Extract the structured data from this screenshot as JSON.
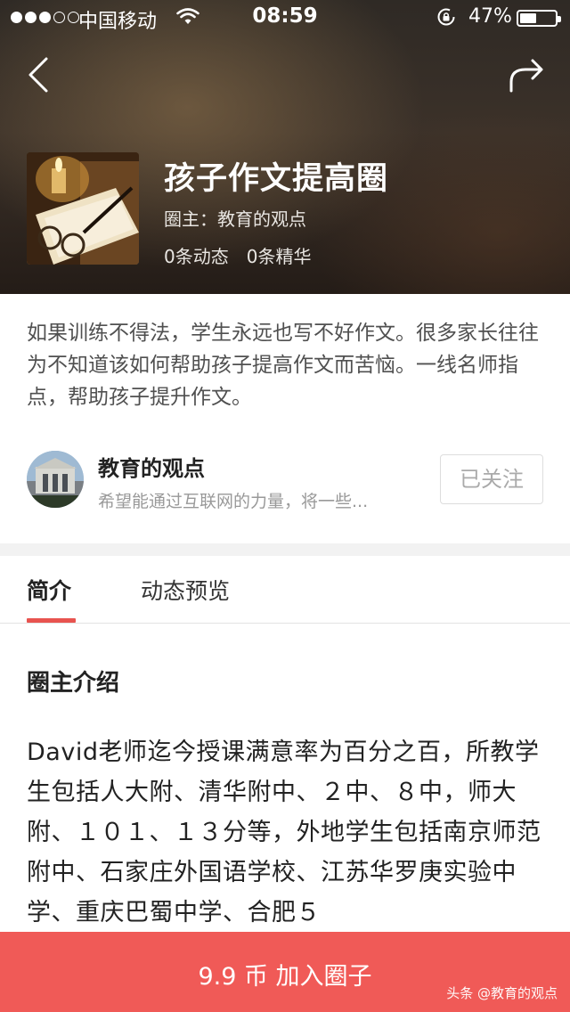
{
  "status_bar": {
    "carrier": "中国移动",
    "time": "08:59",
    "battery_percent": "47%",
    "battery_level": 0.47
  },
  "circle": {
    "title": "孩子作文提高圈",
    "owner_line": "圈主：教育的观点",
    "posts_count": "0条动态",
    "featured_count": "0条精华"
  },
  "description": "如果训练不得法，学生永远也写不好作文。很多家长往往为不知道该如何帮助孩子提高作文而苦恼。一线名师指点，帮助孩子提升作文。",
  "owner": {
    "name": "教育的观点",
    "bio": "希望能通过互联网的力量，将一些...",
    "follow_label": "已关注"
  },
  "tabs": [
    {
      "label": "简介",
      "active": true
    },
    {
      "label": "动态预览",
      "active": false
    }
  ],
  "intro": {
    "heading": "圈主介绍",
    "body": "David老师迄今授课满意率为百分之百，所教学生包括人大附、清华附中、２中、８中，师大附、１０１、１３分等，外地学生包括南京师范附中、石家庄外国语学校、江苏华罗庚实验中学、重庆巴蜀中学、合肥５"
  },
  "join_button": {
    "label": "9.9 币 加入圈子"
  },
  "watermark": "头条 @教育的观点",
  "colors": {
    "accent": "#f05a57",
    "tab_underline": "#e8534f"
  },
  "icons": [
    "back-arrow-icon",
    "share-icon",
    "wifi-icon",
    "lock-rotation-icon",
    "battery-icon"
  ]
}
